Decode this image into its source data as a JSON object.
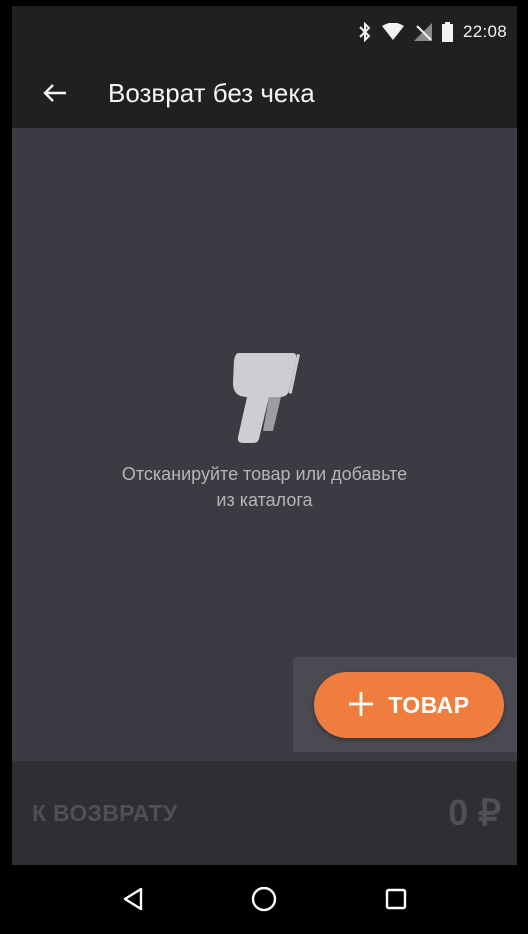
{
  "status_bar": {
    "time": "22:08",
    "icons": [
      "bluetooth-icon",
      "wifi-icon",
      "no-signal-icon",
      "battery-icon"
    ]
  },
  "app_bar": {
    "title": "Возврат без чека",
    "back_icon": "arrow-back-icon"
  },
  "empty_state": {
    "icon": "barcode-scanner-icon",
    "message_line1": "Отсканируйте товар или добавьте",
    "message_line2": "из каталога"
  },
  "add_button": {
    "icon": "plus-icon",
    "label": "ТОВАР",
    "color": "#ef7d3e"
  },
  "total": {
    "label": "К ВОЗВРАТУ",
    "amount": "0 ₽"
  },
  "nav_bar": {
    "icons": [
      "back-triangle-icon",
      "home-circle-icon",
      "recents-square-icon"
    ]
  },
  "colors": {
    "background": "#3b3b43",
    "bars": "#202022",
    "accent": "#ef7d3e"
  }
}
